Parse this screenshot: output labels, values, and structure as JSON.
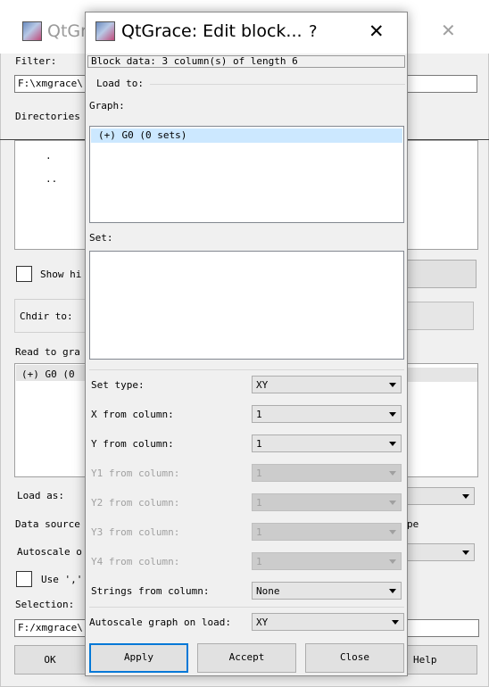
{
  "bg": {
    "title": "QtGr",
    "close_glyph": "✕",
    "filter_label": "Filter:",
    "filter_value": "F:\\xmgrace\\",
    "directories_label": "Directories",
    "dir_items": [
      ".",
      ".."
    ],
    "show_hidden_label": "Show hi",
    "chdir_label": "Chdir to:",
    "read_to_graph_label": "Read to gra",
    "graph_item": "(+) G0 (0",
    "load_as_label": "Load as:",
    "data_source_label": "Data source",
    "data_source_suffix": "pe",
    "autoscale_label": "Autoscale o",
    "use_label": "Use ',' ",
    "selection_label": "Selection:",
    "selection_value": "F:/xmgrace\\",
    "ok_label": "OK",
    "help_label": "Help"
  },
  "dialog": {
    "title": "QtGrace: Edit block...",
    "help_glyph": "?",
    "close_glyph": "✕",
    "block_info": "Block data: 3 column(s) of length 6",
    "load_to_label": "Load to:",
    "graph_label": "Graph:",
    "graph_items": [
      "(+) G0 (0 sets)"
    ],
    "set_label": "Set:",
    "fields": [
      {
        "label": "Set type:",
        "value": "XY",
        "enabled": true
      },
      {
        "label": "X from column:",
        "value": "1",
        "enabled": true
      },
      {
        "label": "Y from column:",
        "value": "1",
        "enabled": true
      },
      {
        "label": "Y1 from column:",
        "value": "1",
        "enabled": false
      },
      {
        "label": "Y2 from column:",
        "value": "1",
        "enabled": false
      },
      {
        "label": "Y3 from column:",
        "value": "1",
        "enabled": false
      },
      {
        "label": "Y4 from column:",
        "value": "1",
        "enabled": false
      },
      {
        "label": "Strings from column:",
        "value": "None",
        "enabled": true
      }
    ],
    "autoscale_label": "Autoscale graph on load:",
    "autoscale_value": "XY",
    "buttons": {
      "apply": "Apply",
      "accept": "Accept",
      "close": "Close"
    }
  },
  "colors": {
    "selection": "#cce8ff",
    "default_button_border": "#0078d7",
    "disabled_text": "#a0a0a0"
  }
}
